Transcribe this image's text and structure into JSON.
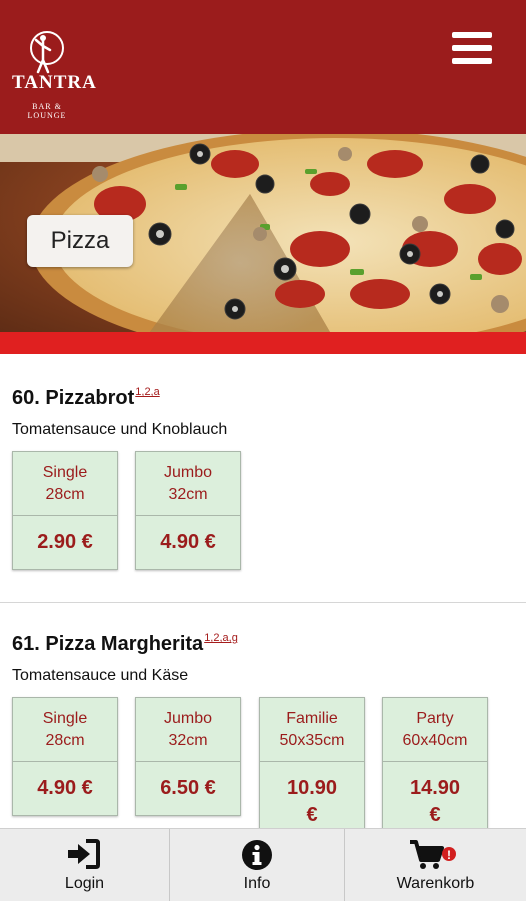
{
  "header": {
    "logo_title": "TANTRA",
    "logo_subtitle": "BAR & LOUNGE",
    "menu_icon": "hamburger-menu-icon",
    "background_color": "#9b1c1c"
  },
  "category": {
    "label": "Pizza",
    "banner_accent": "#e02020"
  },
  "menu_items": [
    {
      "number_name": "60. Pizzabrot",
      "allergens": "1,2,a",
      "description": "Tomatensauce und Knoblauch",
      "prices": [
        {
          "size": "Single",
          "dimension": "28cm",
          "price": "2.90 €"
        },
        {
          "size": "Jumbo",
          "dimension": "32cm",
          "price": "4.90 €"
        }
      ]
    },
    {
      "number_name": "61. Pizza Margherita",
      "allergens": "1,2,a,g",
      "description": "Tomatensauce und Käse",
      "prices": [
        {
          "size": "Single",
          "dimension": "28cm",
          "price": "4.90 €"
        },
        {
          "size": "Jumbo",
          "dimension": "32cm",
          "price": "6.50 €"
        },
        {
          "size": "Familie",
          "dimension": "50x35cm",
          "price": "10.90 €"
        },
        {
          "size": "Party",
          "dimension": "60x40cm",
          "price": "14.90 €"
        }
      ]
    }
  ],
  "bottom_nav": {
    "login": {
      "label": "Login",
      "icon": "login-icon"
    },
    "info": {
      "label": "Info",
      "icon": "info-icon"
    },
    "cart": {
      "label": "Warenkorb",
      "icon": "shopping-cart-icon",
      "badge": "!"
    }
  }
}
